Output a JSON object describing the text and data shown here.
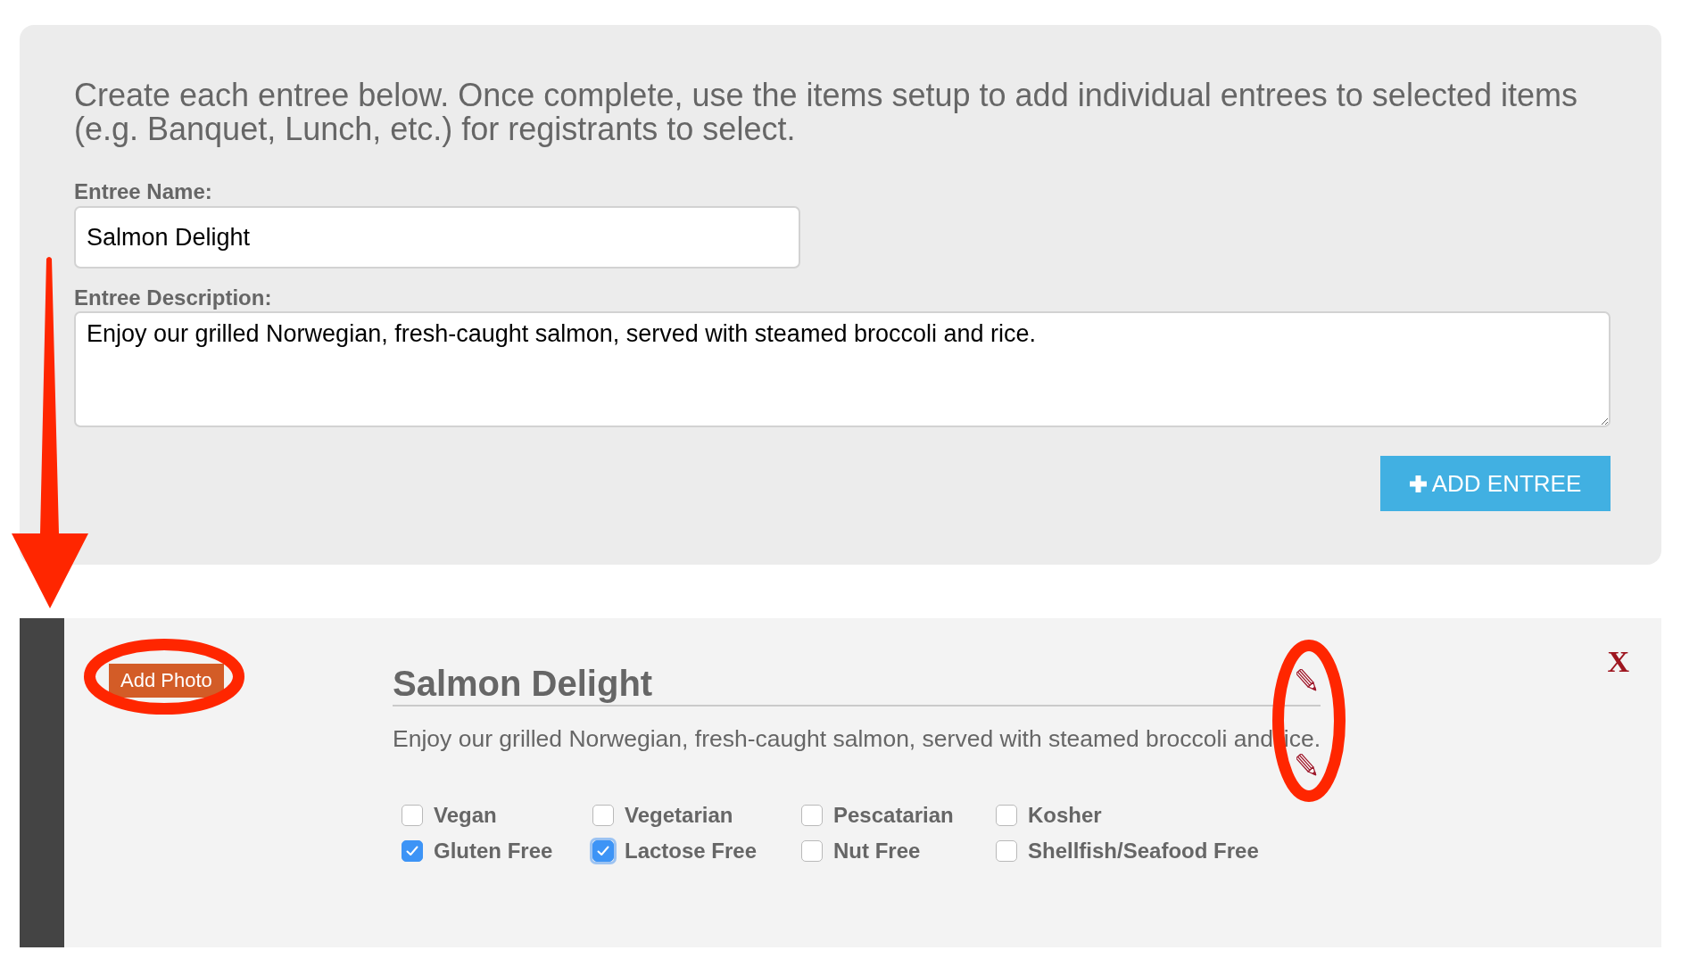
{
  "intro": "Create each entree below. Once complete, use the items setup to add individual entrees to selected items (e.g. Banquet, Lunch, etc.) for registrants to select.",
  "fields": [
    {
      "kind": "input",
      "label": "Entree Name:",
      "value": "Salmon Delight"
    },
    {
      "kind": "textarea",
      "label": "Entree Description:",
      "value": "Enjoy our grilled Norwegian, fresh-caught salmon, served with steamed broccoli and rice."
    }
  ],
  "add_button": {
    "label": "ADD ENTREE"
  },
  "entree": {
    "add_photo": "Add Photo",
    "title": "Salmon Delight",
    "description_parts": [
      "Enjoy our grilled Norwegian, fresh-caught salmon, served with steamed broccoli and",
      "ice."
    ],
    "close": "X",
    "options": [
      {
        "label": "Vegan",
        "checked": false,
        "focused": false
      },
      {
        "label": "Vegetarian",
        "checked": false,
        "focused": false
      },
      {
        "label": "Pescatarian",
        "checked": false,
        "focused": false
      },
      {
        "label": "Kosher",
        "checked": false,
        "focused": false
      },
      {
        "label": "Gluten Free",
        "checked": true,
        "focused": false
      },
      {
        "label": "Lactose Free",
        "checked": true,
        "focused": true
      },
      {
        "label": "Nut Free",
        "checked": false,
        "focused": false
      },
      {
        "label": "Shellfish/Seafood Free",
        "checked": false,
        "focused": false
      }
    ]
  }
}
